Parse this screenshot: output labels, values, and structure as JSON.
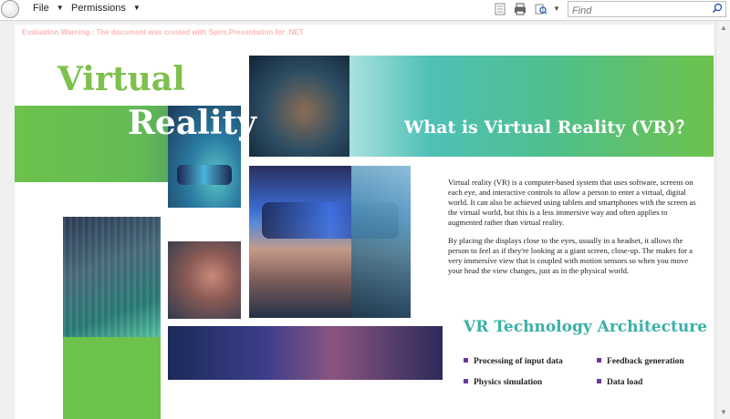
{
  "toolbar": {
    "menu_file": "File",
    "menu_permissions": "Permissions",
    "find_placeholder": "Find",
    "icons": [
      "page-icon",
      "print-icon",
      "zoom-icon",
      "search-icon"
    ]
  },
  "slide": {
    "watermark": "Evaluation Warning : The document was created with  Spire.Presentation for .NET",
    "title_word_1": "Virtual",
    "title_word_2": "Reality",
    "heading": "What is Virtual Reality (VR)？",
    "paragraphs": [
      "Virtual reality (VR) is a computer-based system that uses software, screens on each eye, and interactive controls to allow a person to enter a virtual, digital world. It can also be achieved using tablets and smartphones with the screen as the virtual world, but this is a less immersive way and often applies to augmented rather than virtual reality.",
      "By placing the displays close to the eyes, usually in a headset, it allows the person to feel as if they're looking at a giant screen, close-up. The makes for a very immersive view that is coupled with motion sensors so when you move your head the view changes, just as in the physical world."
    ],
    "section_title": "VR Technology Architecture",
    "architecture": [
      "Processing of input data",
      "Feedback generation",
      "Physics simulation",
      "Data load"
    ],
    "colors": {
      "green": "#6cc24a",
      "teal": "#3ab0a6",
      "bullet": "#6a3a9c"
    }
  }
}
